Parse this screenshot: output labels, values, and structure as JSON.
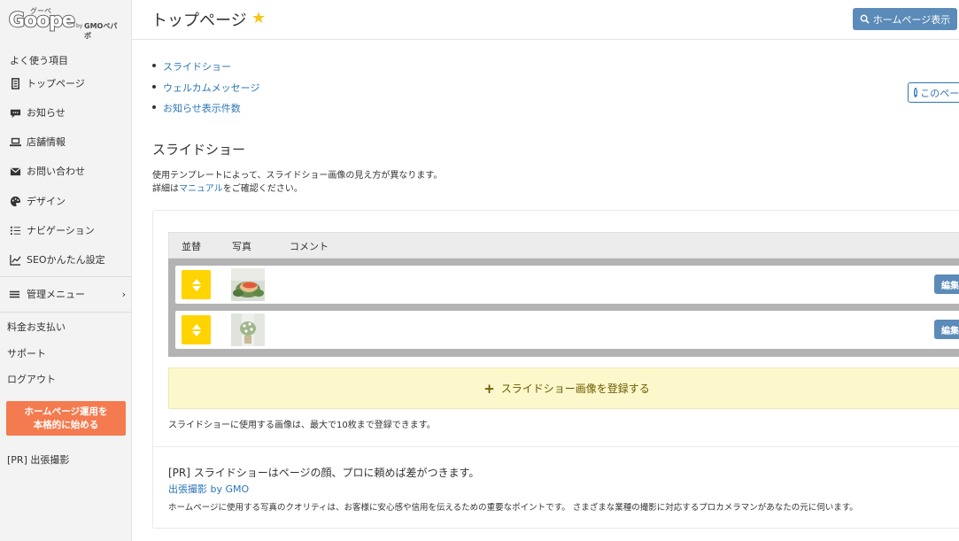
{
  "app": {
    "logo_text": "Goope",
    "logo_tag": "グーペ",
    "logo_by": "by",
    "logo_brand": "GMOペパボ"
  },
  "sidebar": {
    "section_title": "よく使う項目",
    "items": [
      {
        "label": "トップページ",
        "icon": "page-icon"
      },
      {
        "label": "お知らせ",
        "icon": "chat-icon"
      },
      {
        "label": "店舗情報",
        "icon": "laptop-icon"
      },
      {
        "label": "お問い合わせ",
        "icon": "mail-icon"
      },
      {
        "label": "デザイン",
        "icon": "palette-icon"
      },
      {
        "label": "ナビゲーション",
        "icon": "list-icon"
      },
      {
        "label": "SEOかんたん設定",
        "icon": "chart-icon"
      }
    ],
    "admin_menu": "管理メニュー",
    "links": [
      "料金お支払い",
      "サポート",
      "ログアウト"
    ],
    "cta_line1": "ホームページ運用を",
    "cta_line2": "本格的に始める",
    "pr_link": "[PR] 出張撮影",
    "cta_color": "#f47b4f"
  },
  "header": {
    "title": "トップページ",
    "star": "★",
    "view_button": "ホームページ表示"
  },
  "toc": [
    "スライドショー",
    "ウェルカムメッセージ",
    "お知らせ表示件数"
  ],
  "help_button": "このページ",
  "slideshow": {
    "heading": "スライドショー",
    "desc_line1": "使用テンプレートによって、スライドショー画像の見え方が異なります。",
    "desc_prefix": "詳細は",
    "desc_link": "マニュアル",
    "desc_suffix": "をご確認ください。",
    "columns": [
      "並替",
      "写真",
      "コメント"
    ],
    "rows": [
      {
        "edit": "編集",
        "photo": "sandwich"
      },
      {
        "edit": "編集",
        "photo": "flowers"
      }
    ],
    "add_label": "スライドショー画像を登録する",
    "note": "スライドショーに使用する画像は、最大で10枚まで登録できます。"
  },
  "pr": {
    "title": "[PR] スライドショーはページの顔、プロに頼めば差がつきます。",
    "link": "出張撮影 by GMO",
    "desc": "ホームページに使用する写真のクオリティは、お客様に安心感や信用を伝えるための重要なポイントです。 さまざまな業種の撮影に対応するプロカメラマンがあなたの元に伺います。"
  },
  "colors": {
    "accent": "#5b8bb8",
    "link": "#2a76b8",
    "handle": "#ffd400",
    "add_bg": "#fdf8cc"
  }
}
